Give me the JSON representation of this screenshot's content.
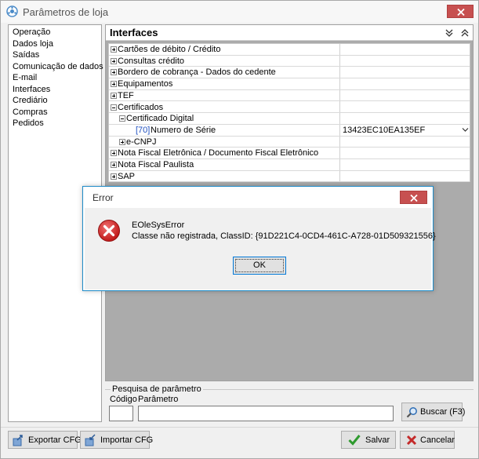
{
  "window": {
    "title": "Parâmetros de loja"
  },
  "sidebar": {
    "items": [
      "Operação",
      "Dados loja",
      "Saídas",
      "Comunicação de dados",
      "E-mail",
      "Interfaces",
      "Crediário",
      "Compras",
      "Pedidos"
    ]
  },
  "panel": {
    "title": "Interfaces",
    "rows": [
      {
        "label": "Cartões de débito / Crédito",
        "value": ""
      },
      {
        "label": "Consultas crédito",
        "value": ""
      },
      {
        "label": "Bordero de cobrança - Dados do cedente",
        "value": ""
      },
      {
        "label": "Equipamentos",
        "value": ""
      },
      {
        "label": "TEF",
        "value": ""
      },
      {
        "label": "Certificados",
        "value": ""
      },
      {
        "label": "Certificado Digital",
        "value": ""
      },
      {
        "code": "[70]",
        "label": "Numero de Série",
        "value": "13423EC10EA135EF"
      },
      {
        "label": "e-CNPJ",
        "value": ""
      },
      {
        "label": "Nota Fiscal Eletrônica / Documento Fiscal Eletrônico",
        "value": ""
      },
      {
        "label": "Nota Fiscal Paulista",
        "value": ""
      },
      {
        "label": "SAP",
        "value": ""
      }
    ]
  },
  "search": {
    "legend": "Pesquisa de parâmetro",
    "code_label": "Código",
    "param_label": "Parâmetro",
    "code_value": "",
    "param_value": "",
    "search_button": "Buscar (F3)"
  },
  "footer": {
    "export_button": "Exportar CFG",
    "import_button": "Importar CFG",
    "save_button": "Salvar",
    "cancel_button": "Cancelar"
  },
  "dialog": {
    "title": "Error",
    "error_type": "EOleSysError",
    "message": "Classe não registrada, ClassID: {91D221C4-0CD4-461C-A728-01D509321556}",
    "ok_button": "OK"
  },
  "colors": {
    "close_red": "#c75050",
    "dialog_border": "#1f8bc8",
    "code_blue": "#2050c0",
    "error_red": "#d02020"
  }
}
